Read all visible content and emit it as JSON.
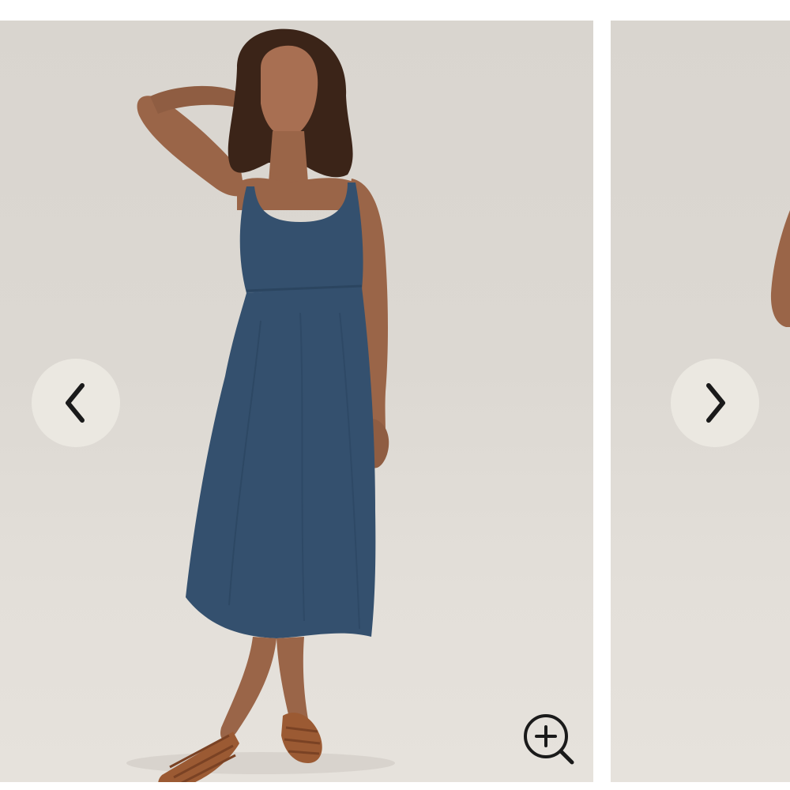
{
  "gallery": {
    "slides": [
      {
        "alt": "",
        "icon": "photo-model-navy-dress"
      },
      {
        "alt": "",
        "icon": "photo-model-partial"
      }
    ],
    "prev_button": {
      "label": "",
      "icon": "chevron-left-icon"
    },
    "next_button": {
      "label": "",
      "icon": "chevron-right-icon"
    },
    "zoom_button": {
      "label": "",
      "icon": "zoom-in-icon"
    }
  },
  "colors": {
    "page_background": "#ffffff",
    "photo_background": "#dcd8d2",
    "nav_button_fill": "#ebe8e1",
    "icon_color": "#1a1a1a",
    "dress_color": "#34506e",
    "skin_color": "#9a6548",
    "sandal_color": "#9b5a33"
  }
}
